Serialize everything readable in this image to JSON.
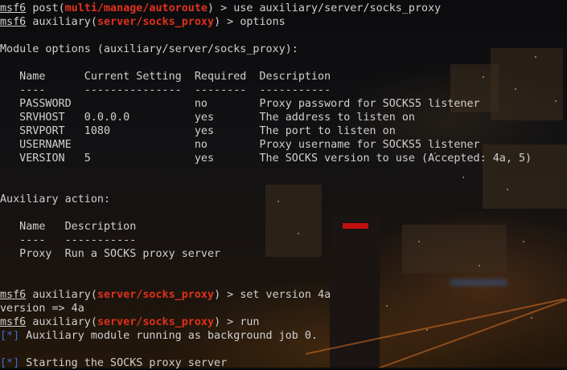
{
  "terminal": {
    "lines": [
      {
        "prompt": "msf6",
        "ctx": "post",
        "module": "multi/manage/autoroute",
        "command": "use auxiliary/server/socks_proxy"
      },
      {
        "prompt": "msf6",
        "ctx": "auxiliary",
        "module": "server/socks_proxy",
        "command": "options"
      },
      {
        "text": "Module options (auxiliary/server/socks_proxy):"
      },
      {
        "text": "   Name      Current Setting  Required  Description"
      },
      {
        "text": "   ----      ---------------  --------  -----------"
      },
      {
        "text": "   PASSWORD                   no        Proxy password for SOCKS5 listener"
      },
      {
        "text": "   SRVHOST   0.0.0.0          yes       The address to listen on"
      },
      {
        "text": "   SRVPORT   1080             yes       The port to listen on"
      },
      {
        "text": "   USERNAME                   no        Proxy username for SOCKS5 listener"
      },
      {
        "text": "   VERSION   5                yes       The SOCKS version to use (Accepted: 4a, 5)"
      },
      {
        "text": "Auxiliary action:"
      },
      {
        "text": "   Name   Description"
      },
      {
        "text": "   ----   -----------"
      },
      {
        "text": "   Proxy  Run a SOCKS proxy server"
      },
      {
        "prompt": "msf6",
        "ctx": "auxiliary",
        "module": "server/socks_proxy",
        "command": "set version 4a"
      },
      {
        "text": "version => 4a"
      },
      {
        "prompt": "msf6",
        "ctx": "auxiliary",
        "module": "server/socks_proxy",
        "command": "run"
      },
      {
        "status": "[*]",
        "text": "Auxiliary module running as background job 0."
      },
      {
        "status": "[*]",
        "text": "Starting the SOCKS proxy server"
      }
    ]
  },
  "colors": {
    "text": "#d0d0d0",
    "module_red": "#e0311b",
    "status_blue": "#3b6fcf"
  }
}
